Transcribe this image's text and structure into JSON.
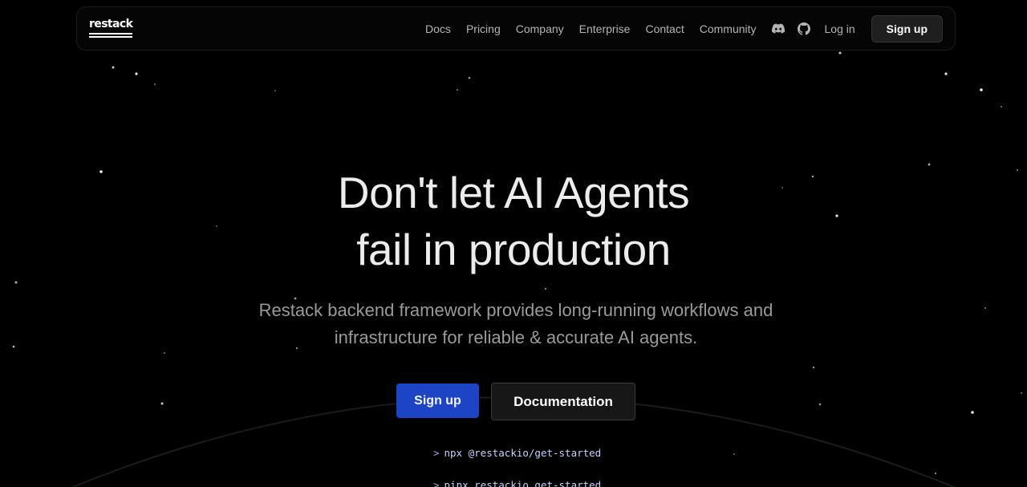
{
  "brand": {
    "logo_text": "restack"
  },
  "nav": {
    "links": [
      "Docs",
      "Pricing",
      "Company",
      "Enterprise",
      "Contact",
      "Community"
    ],
    "discord_icon": "discord-icon",
    "github_icon": "github-icon",
    "login_label": "Log in",
    "signup_label": "Sign up"
  },
  "hero": {
    "title_line1": "Don't let AI Agents",
    "title_line2": "fail in production",
    "subtitle_line1": "Restack backend framework provides long-running workflows and",
    "subtitle_line2": "infrastructure for reliable & accurate AI agents.",
    "primary_cta": "Sign up",
    "secondary_cta": "Documentation"
  },
  "commands": {
    "prompt": ">",
    "lines": [
      "npx @restackio/get-started",
      "pipx restackio get-started"
    ]
  },
  "colors": {
    "background": "#000000",
    "primary_button": "#1c44c4",
    "secondary_button": "#171717",
    "command_text": "#c5d3ff"
  }
}
